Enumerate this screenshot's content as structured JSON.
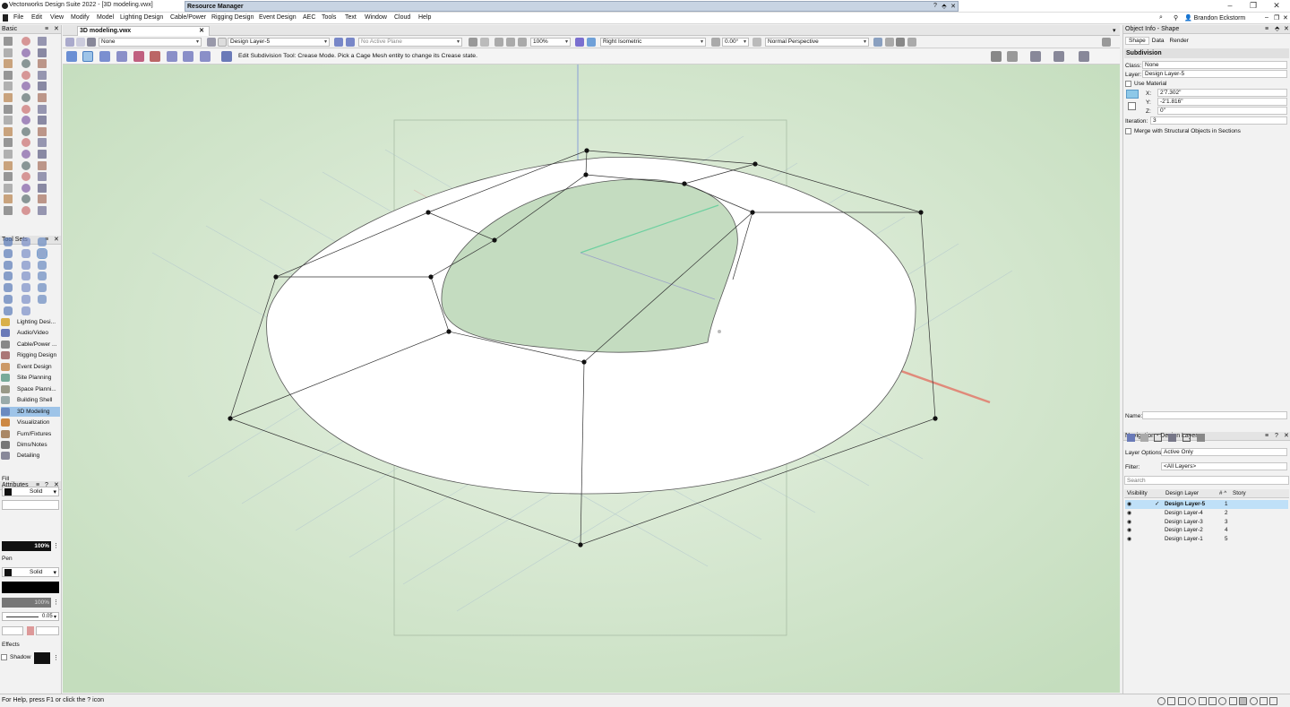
{
  "app": {
    "title": "Vectorworks Design Suite 2022 - [3D modeling.vwx]",
    "user": "Brandon Eckstorm"
  },
  "resource_manager": {
    "title": "Resource Manager"
  },
  "menu": [
    "File",
    "Edit",
    "View",
    "Modify",
    "Model",
    "Lighting Design",
    "Cable/Power",
    "Rigging Design",
    "Event Design",
    "AEC",
    "Tools",
    "Text",
    "Window",
    "Cloud",
    "Help"
  ],
  "palettes": {
    "basic": "Basic",
    "tool_sets": "Tool Sets",
    "attributes": "Attributes"
  },
  "tool_sets": [
    {
      "label": "Lighting Desi..."
    },
    {
      "label": "Audio/Video"
    },
    {
      "label": "Cable/Power ..."
    },
    {
      "label": "Rigging Design"
    },
    {
      "label": "Event Design"
    },
    {
      "label": "Site Planning"
    },
    {
      "label": "Space Planni..."
    },
    {
      "label": "Building Shell"
    },
    {
      "label": "3D Modeling",
      "selected": true
    },
    {
      "label": "Visualization"
    },
    {
      "label": "Furn/Fixtures"
    },
    {
      "label": "Dims/Notes"
    },
    {
      "label": "Detailing"
    }
  ],
  "attributes": {
    "fill_label": "Fill",
    "fill_style": "Solid",
    "fill_opacity": "100%",
    "pen_label": "Pen",
    "pen_style": "Solid",
    "pen_opacity": "100%",
    "line_weight": "0.05",
    "effects_label": "Effects",
    "shadow_label": "Shadow"
  },
  "document": {
    "tab": "3D modeling.vwx"
  },
  "view_bar": {
    "class": "None",
    "layer": "Design Layer-5",
    "plane": "No Active Plane",
    "zoom": "100%",
    "view": "Right Isometric",
    "angle": "0.00°",
    "render": "Normal Perspective"
  },
  "mode_hint": "Edit Subdivision Tool: Crease Mode. Pick a Cage Mesh entity to change its Crease state.",
  "object_info": {
    "title": "Object Info - Shape",
    "tabs": [
      "Shape",
      "Data",
      "Render"
    ],
    "type": "Subdivision",
    "class_label": "Class:",
    "class_value": "None",
    "layer_label": "Layer:",
    "layer_value": "Design Layer-5",
    "use_material": "Use Material",
    "x_label": "X:",
    "x_value": "2'7.302\"",
    "y_label": "Y:",
    "y_value": "-2'1.816\"",
    "z_label": "Z:",
    "z_value": "0\"",
    "iteration_label": "Iteration:",
    "iteration_value": "3",
    "merge_label": "Merge with Structural Objects in Sections",
    "name_label": "Name:"
  },
  "navigation": {
    "title": "Navigation - Design Layers",
    "layer_options_label": "Layer Options",
    "layer_options_value": "Active Only",
    "filter_label": "Filter:",
    "filter_value": "<All Layers>",
    "search_placeholder": "Search",
    "col_visibility": "Visibility",
    "col_design_layer": "Design Layer",
    "col_sort": "# ^",
    "col_story": "Story",
    "layers": [
      {
        "name": "Design Layer-5",
        "num": "1",
        "active": true
      },
      {
        "name": "Design Layer-4",
        "num": "2"
      },
      {
        "name": "Design Layer-3",
        "num": "3"
      },
      {
        "name": "Design Layer-2",
        "num": "4"
      },
      {
        "name": "Design Layer-1",
        "num": "5"
      }
    ]
  },
  "status": {
    "help": "For Help, press F1 or click the ? icon"
  },
  "colors": {
    "canvas_bg": "#cfe3c8",
    "selected": "#9ec4e8",
    "accent": "#4a7fc1"
  }
}
